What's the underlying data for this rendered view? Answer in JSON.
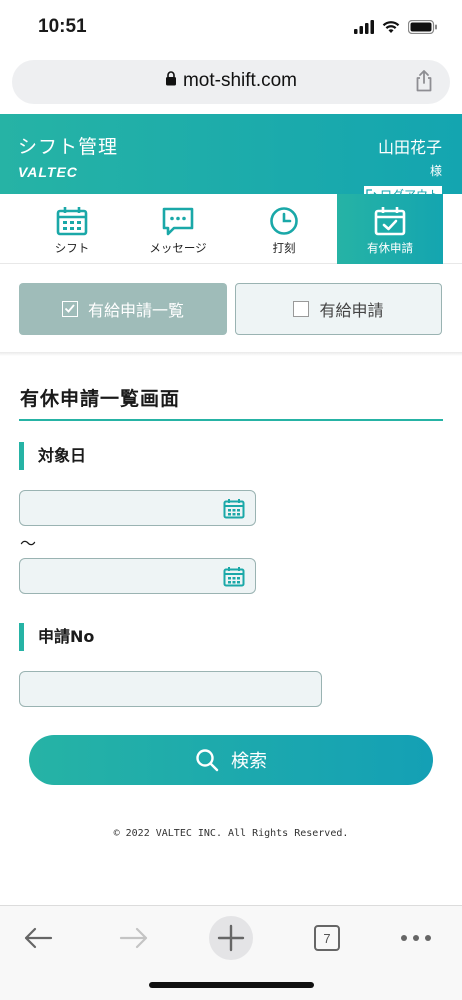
{
  "status_bar": {
    "time": "10:51"
  },
  "browser": {
    "url": "mot-shift.com",
    "tab_count": "7"
  },
  "header": {
    "title": "シフト管理",
    "brand": "VALTEC",
    "user_name": "山田花子",
    "user_suffix": "様",
    "logout_label": "ログアウト"
  },
  "nav": {
    "items": [
      {
        "label": "シフト",
        "icon": "calendar-icon"
      },
      {
        "label": "メッセージ",
        "icon": "chat-icon"
      },
      {
        "label": "打刻",
        "icon": "clock-icon"
      },
      {
        "label": "有休申請",
        "icon": "calendar-check-icon",
        "active": true
      }
    ]
  },
  "subtabs": {
    "list_label": "有給申請一覧",
    "apply_label": "有給申請"
  },
  "page": {
    "title": "有休申請一覧画面",
    "target_date_label": "対象日",
    "date_from_value": "",
    "range_separator": "～",
    "date_to_value": "",
    "application_no_label": "申請No",
    "application_no_value": "",
    "search_label": "検索"
  },
  "footer": {
    "copyright": "© 2022 VALTEC INC. All Rights Reserved."
  },
  "colors": {
    "accent": "#26b3a5",
    "accent_dark": "#14a5b0",
    "tab_active_bg": "#9fbcb9",
    "input_bg": "#eef4f5"
  }
}
